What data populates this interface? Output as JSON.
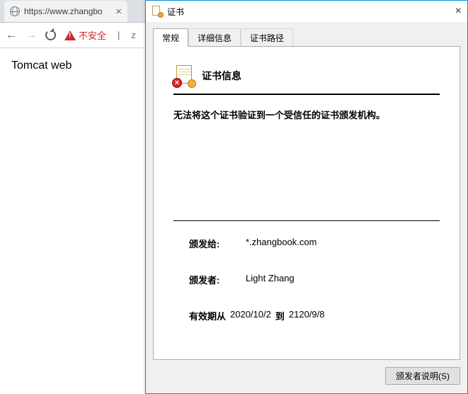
{
  "browser": {
    "tab_title": "https://www.zhangbo",
    "nav_back": "←",
    "nav_fwd": "→",
    "not_secure_label": "不安全",
    "address_rest_divider": "|",
    "address_rest": "z",
    "close_glyph": "×"
  },
  "page": {
    "heading": "Tomcat web"
  },
  "dialog": {
    "title": "证书",
    "close_glyph": "×",
    "tabs": {
      "general": "常规",
      "details": "详细信息",
      "path": "证书路径"
    },
    "cert_info_title": "证书信息",
    "error_glyph": "×",
    "warning_message": "无法将这个证书验证到一个受信任的证书颁发机构。",
    "fields": {
      "issued_to_label": "颁发给:",
      "issued_to_value": "*.zhangbook.com",
      "issuer_label": "颁发者:",
      "issuer_value": "Light Zhang",
      "valid_label": "有效期从",
      "valid_from": "2020/10/2",
      "valid_sep": "到",
      "valid_to": "2120/9/8"
    },
    "footer_btn": "颁发者说明(S)"
  }
}
